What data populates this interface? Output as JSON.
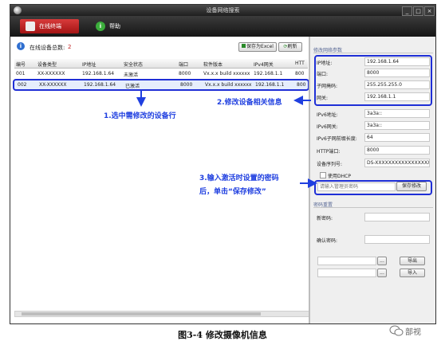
{
  "window": {
    "title": "设备网络搜索",
    "controls": [
      "_",
      "□",
      "×"
    ]
  },
  "tabs": [
    {
      "label": "在线终端",
      "icon": "monitor-icon",
      "active": true
    },
    {
      "label": "帮助",
      "icon": "info-icon",
      "active": false
    }
  ],
  "device_list": {
    "count_label": "在线设备总数:",
    "count": "2",
    "export_label": "保存为Excel",
    "refresh_label": "刷新",
    "columns": [
      "编号",
      "设备类型",
      "IP地址",
      "安全状态",
      "端口",
      "软件版本",
      "IPv4网关",
      "HTT"
    ],
    "rows": [
      [
        "001",
        "XX-XXXXXX",
        "192.168.1.64",
        "未激活",
        "8000",
        "Vx.x.x build xxxxxx",
        "192.168.1.1",
        "800"
      ],
      [
        "002",
        "XX-XXXXXX",
        "192.168.1.64",
        "已激活",
        "8000",
        "Vx.x.x build xxxxxx",
        "192.168.1.1",
        "800"
      ]
    ]
  },
  "settings": {
    "section_title": "修改网络参数",
    "ip_label": "IP地址:",
    "ip_value": "192.168.1.64",
    "port_label": "端口:",
    "port_value": "8000",
    "mask_label": "子网掩码:",
    "mask_value": "255.255.255.0",
    "gateway_label": "网关:",
    "gateway_value": "192.168.1.1",
    "ipv6_label": "IPv6地址:",
    "ipv6_value": "3a3a::",
    "ipv6gw_label": "IPv6网关:",
    "ipv6gw_value": "3a3a::",
    "ipv6prefix_label": "IPv6子网前缀长度:",
    "ipv6prefix_value": "64",
    "http_label": "HTTP端口:",
    "http_value": "8000",
    "serial_label": "设备序列号:",
    "serial_value": "DS-XXXXXXXXXXXXXXXXX",
    "dhcp_label": "使用DHCP",
    "admin_pwd_placeholder": "请输入管理员密码",
    "save_label": "保存修改",
    "pwd_section_title": "密码重置",
    "new_pwd_label": "新密码:",
    "confirm_pwd_label": "确认密码:",
    "export_label": "导出",
    "import_label": "导入",
    "browse_label": "..."
  },
  "annotations": {
    "step1": "1.选中需修改的设备行",
    "step2": "2.修改设备相关信息",
    "step3_line1": "3.输入激活时设置的密码",
    "step3_line2": "后，单击“保存修改”"
  },
  "caption": "图3-4  修改摄像机信息",
  "watermark": "部视",
  "colors": {
    "annotation_blue": "#1f3fe0",
    "active_tab_red": "#c02020"
  }
}
